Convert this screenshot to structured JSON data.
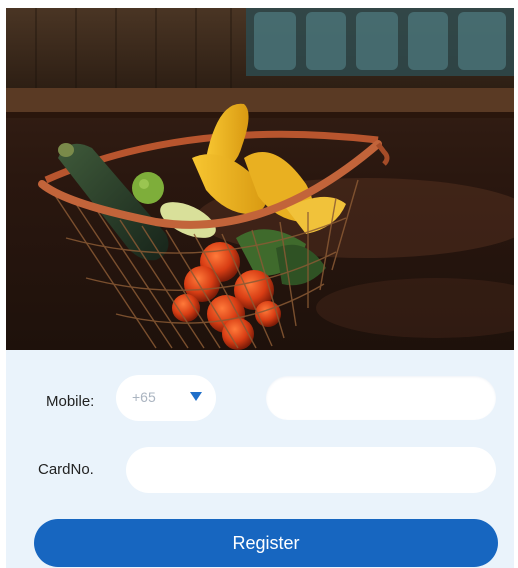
{
  "hero": {
    "image": "grocery-basket-with-vegetables"
  },
  "form": {
    "mobile_label": "Mobile:",
    "country_code": "+65",
    "mobile_placeholder": "",
    "card_label": "CardNo.",
    "card_placeholder": "",
    "register_label": "Register"
  },
  "colors": {
    "form_background": "#eaf3fb",
    "primary": "#1766c0",
    "caret": "#1f6fc9"
  }
}
